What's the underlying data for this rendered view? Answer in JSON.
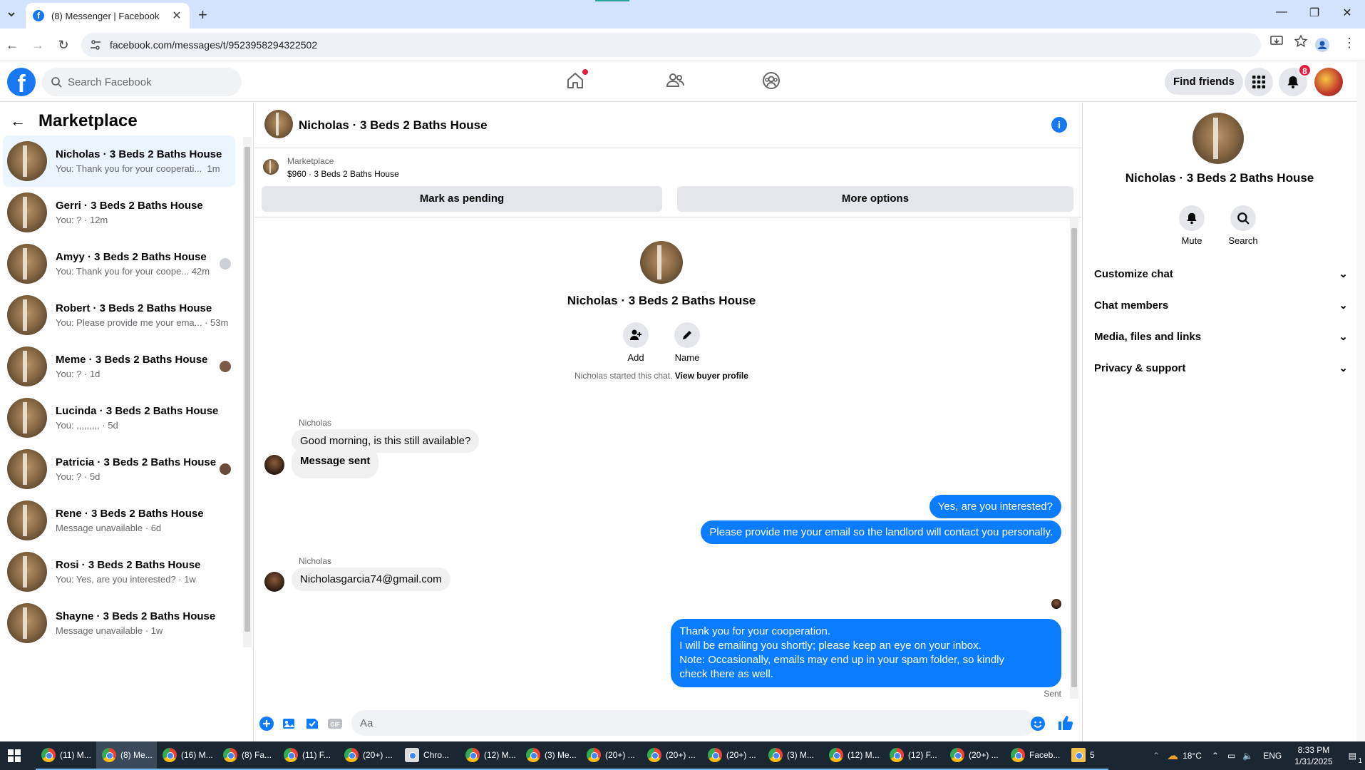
{
  "browser": {
    "tab_title": "(8) Messenger | Facebook",
    "url": "facebook.com/messages/t/9523958294322502"
  },
  "fb": {
    "search_placeholder": "Search Facebook",
    "find_friends": "Find friends",
    "notif_count": "8"
  },
  "sidebar": {
    "title": "Marketplace",
    "conversations": [
      {
        "name": "Nicholas · 3 Beds 2 Baths House",
        "preview": "You: Thank you for your cooperati...",
        "time": "1m"
      },
      {
        "name": "Gerri · 3 Beds 2 Baths House",
        "preview": "You: ? · 12m",
        "time": ""
      },
      {
        "name": "Amyy · 3 Beds 2 Baths House",
        "preview": "You: Thank you for your coope...",
        "time": "42m"
      },
      {
        "name": "Robert · 3 Beds 2 Baths House",
        "preview": "You: Please provide me your ema...",
        "time": "53m"
      },
      {
        "name": "Meme · 3 Beds 2 Baths House",
        "preview": "You: ? · 1d",
        "time": ""
      },
      {
        "name": "Lucinda · 3 Beds 2 Baths House",
        "preview": "You: ,,,,,,,,, · 5d",
        "time": ""
      },
      {
        "name": "Patricia · 3 Beds 2 Baths House",
        "preview": "You: ? · 5d",
        "time": ""
      },
      {
        "name": "Rene · 3 Beds 2 Baths House",
        "preview": "Message unavailable · 6d",
        "time": ""
      },
      {
        "name": "Rosi · 3 Beds 2 Baths House",
        "preview": "You: Yes, are you interested? · 1w",
        "time": ""
      },
      {
        "name": "Shayne · 3 Beds 2 Baths House",
        "preview": "Message unavailable · 1w",
        "time": ""
      }
    ]
  },
  "chat": {
    "title": "Nicholas · 3 Beds 2 Baths House",
    "listing_label": "Marketplace",
    "listing_price": "$960 · 3 Beds 2 Baths House",
    "mark_pending": "Mark as pending",
    "more_options": "More options",
    "intro_name": "Nicholas · 3 Beds 2 Baths House",
    "add_label": "Add",
    "name_label": "Name",
    "started_text": "Nicholas started this chat.",
    "view_profile": "View buyer profile",
    "sender1": "Nicholas",
    "msg1": "Good morning, is this still available?",
    "msg2": "Message sent",
    "msg3": "Yes, are you interested?",
    "msg4": "Please provide me your email so the landlord will contact you personally.",
    "sender2": "Nicholas",
    "msg5": "Nicholasgarcia74@gmail.com",
    "msg6_l1": "Thank you for your cooperation.",
    "msg6_l2": "I will be emailing you shortly; please keep an eye on your inbox.",
    "msg6_l3": "Note: Occasionally, emails may end up in your spam folder, so kindly",
    "msg6_l4": "check there as well.",
    "sent_label": "Sent",
    "composer_placeholder": "Aa"
  },
  "right_panel": {
    "name": "Nicholas · 3 Beds 2 Baths House",
    "mute": "Mute",
    "search": "Search",
    "items": [
      "Customize chat",
      "Chat members",
      "Media, files and links",
      "Privacy & support"
    ]
  },
  "taskbar": {
    "items": [
      "(11) M...",
      "(8) Me...",
      "(16) M...",
      "(8) Fa...",
      "(11) F...",
      "(20+) ...",
      "Chro...",
      "(12) M...",
      "(3) Me...",
      "(20+) ...",
      "(20+) ...",
      "(20+) ...",
      "(3) M...",
      "(12) M...",
      "(12) F...",
      "(20+) ...",
      "Faceb...",
      "5"
    ],
    "weather": "18°C",
    "lang": "ENG",
    "time": "8:33 PM",
    "date": "1/31/2025",
    "notif": "1"
  }
}
